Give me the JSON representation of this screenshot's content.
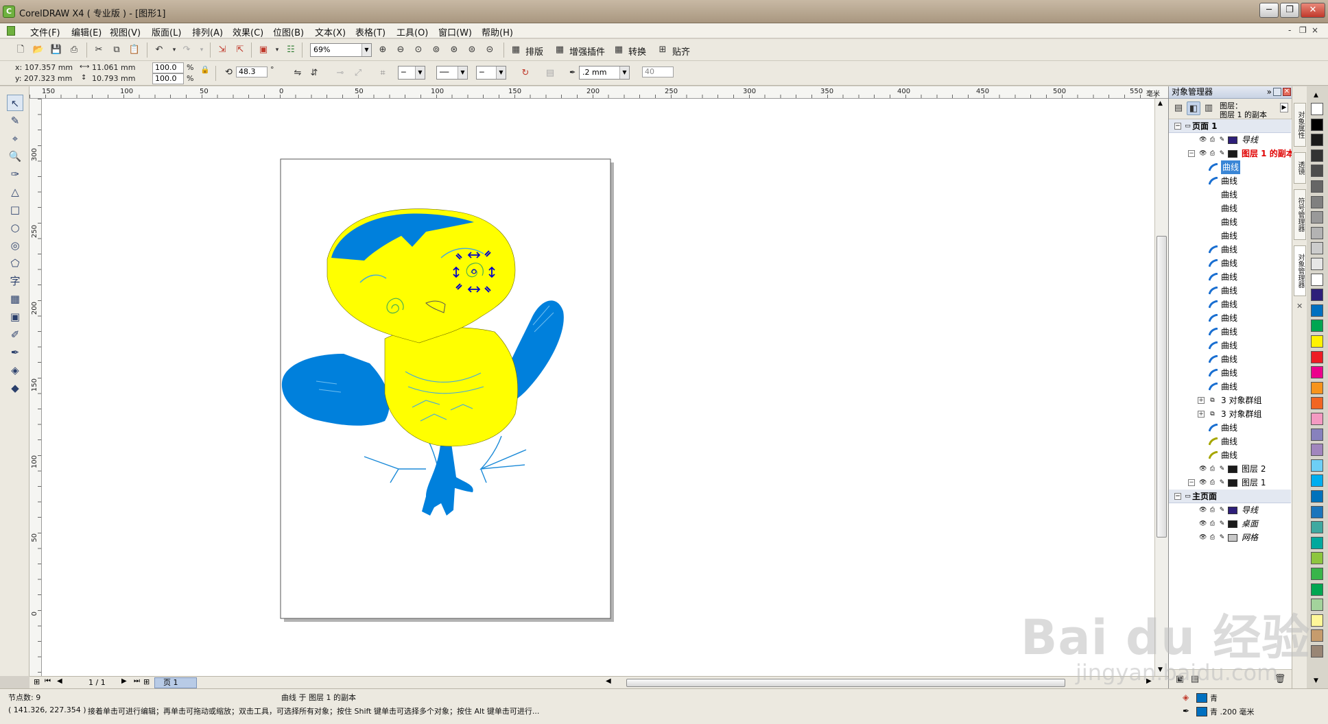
{
  "window": {
    "title": "CorelDRAW X4 ( 专业版 ) - [图形1]",
    "minimize": "─",
    "restore": "❐",
    "close": "✕"
  },
  "menu": {
    "items": [
      "文件(F)",
      "编辑(E)",
      "视图(V)",
      "版面(L)",
      "排列(A)",
      "效果(C)",
      "位图(B)",
      "文本(X)",
      "表格(T)",
      "工具(O)",
      "窗口(W)",
      "帮助(H)"
    ],
    "doc_controls": [
      "-",
      "❐",
      "×"
    ]
  },
  "toolbar": {
    "zoom": "69%",
    "buttons": [
      "排版",
      "增强插件",
      "转换",
      "贴齐"
    ]
  },
  "property_bar": {
    "x": "x: 107.357 mm",
    "y": "y: 207.323 mm",
    "width": "11.061 mm",
    "height": "10.793 mm",
    "scale_x": "100.0",
    "scale_y": "100.0",
    "percent": "%",
    "angle": "48.3",
    "degree": "°",
    "outline_width": ".2 mm",
    "nib": "40"
  },
  "rulers": {
    "horizontal": [
      "150",
      "100",
      "50",
      "0",
      "50",
      "100",
      "150",
      "200",
      "250",
      "300",
      "350",
      "400",
      "450",
      "500",
      "550"
    ],
    "vertical": [
      "300",
      "250",
      "200",
      "150",
      "100",
      "50",
      "0"
    ],
    "unit": "毫米"
  },
  "object_manager": {
    "title": "对象管理器",
    "header_page": "图层：",
    "header_layer": "图层 1   的副本",
    "rows": [
      {
        "label": "页面 1",
        "type": "section"
      },
      {
        "label": "导线",
        "type": "layer",
        "italic": true,
        "color": "#2e1f7a"
      },
      {
        "label": "图层 1   的副本",
        "type": "layer-active",
        "color": "#1a1a1a"
      },
      {
        "label": "曲线",
        "type": "curve",
        "selected": true,
        "icon": "blue"
      },
      {
        "label": "曲线",
        "type": "curve",
        "icon": "blue"
      },
      {
        "label": "曲线",
        "type": "curve",
        "icon": "none"
      },
      {
        "label": "曲线",
        "type": "curve",
        "icon": "none"
      },
      {
        "label": "曲线",
        "type": "curve",
        "icon": "none"
      },
      {
        "label": "曲线",
        "type": "curve",
        "icon": "none"
      },
      {
        "label": "曲线",
        "type": "curve",
        "icon": "blue"
      },
      {
        "label": "曲线",
        "type": "curve",
        "icon": "blue"
      },
      {
        "label": "曲线",
        "type": "curve",
        "icon": "blue"
      },
      {
        "label": "曲线",
        "type": "curve",
        "icon": "blue"
      },
      {
        "label": "曲线",
        "type": "curve",
        "icon": "blue"
      },
      {
        "label": "曲线",
        "type": "curve",
        "icon": "blue"
      },
      {
        "label": "曲线",
        "type": "curve",
        "icon": "blue"
      },
      {
        "label": "曲线",
        "type": "curve",
        "icon": "blue"
      },
      {
        "label": "曲线",
        "type": "curve",
        "icon": "blue"
      },
      {
        "label": "曲线",
        "type": "curve",
        "icon": "blue"
      },
      {
        "label": "曲线",
        "type": "curve",
        "icon": "blue"
      },
      {
        "label": "3 对象群组",
        "type": "group"
      },
      {
        "label": "3 对象群组",
        "type": "group"
      },
      {
        "label": "曲线",
        "type": "curve",
        "icon": "blue"
      },
      {
        "label": "曲线",
        "type": "curve",
        "icon": "yellow"
      },
      {
        "label": "曲线",
        "type": "curve",
        "icon": "yellow"
      },
      {
        "label": "图层 2",
        "type": "layer",
        "color": "#1a1a1a"
      },
      {
        "label": "图层 1",
        "type": "layer",
        "color": "#1a1a1a"
      },
      {
        "label": "主页面",
        "type": "section"
      },
      {
        "label": "导线",
        "type": "layer",
        "italic": true,
        "color": "#2e1f7a"
      },
      {
        "label": "桌面",
        "type": "layer",
        "italic": true,
        "color": "#1a1a1a"
      },
      {
        "label": "网格",
        "type": "layer",
        "italic": true,
        "color": "#c8c8c8"
      }
    ]
  },
  "docker_tabs": [
    "对象属性",
    "透镜",
    "符号管理器",
    "对象管理器"
  ],
  "page_nav": {
    "counter": "1 / 1",
    "tab": "页 1"
  },
  "status": {
    "nodes": "节点数: 9",
    "object_info": "曲线 于 图层 1   的副本",
    "coords": "( 141.326, 227.354 )",
    "hint": "接着单击可进行编辑；再单击可拖动或缩放；双击工具，可选择所有对象；按住 Shift 键单击可选择多个对象；按住 Alt 键单击可进行...",
    "fill_label": "青",
    "outline_label": "青 .200 毫米"
  },
  "palette": [
    "#ffffff",
    "#000000",
    "#1a1a1a",
    "#333333",
    "#4d4d4d",
    "#666666",
    "#808080",
    "#999999",
    "#b3b3b3",
    "#cccccc",
    "#e6e6e6",
    "#ffffff",
    "#2e1f7a",
    "#0070c0",
    "#00a651",
    "#fff200",
    "#ed1c24",
    "#ec008c",
    "#f7941d",
    "#f26522",
    "#f49ac2",
    "#8781bd",
    "#a186be",
    "#6dcff6",
    "#00aeef",
    "#0072bc",
    "#1b75bc",
    "#3fa9a0",
    "#00a99d",
    "#8dc63f",
    "#39b54a",
    "#00a651",
    "#a3d39c",
    "#fff799",
    "#c69c6d",
    "#998675"
  ],
  "watermark": {
    "brand": "Bai du 经验",
    "url": "jingyan.baidu.com"
  }
}
